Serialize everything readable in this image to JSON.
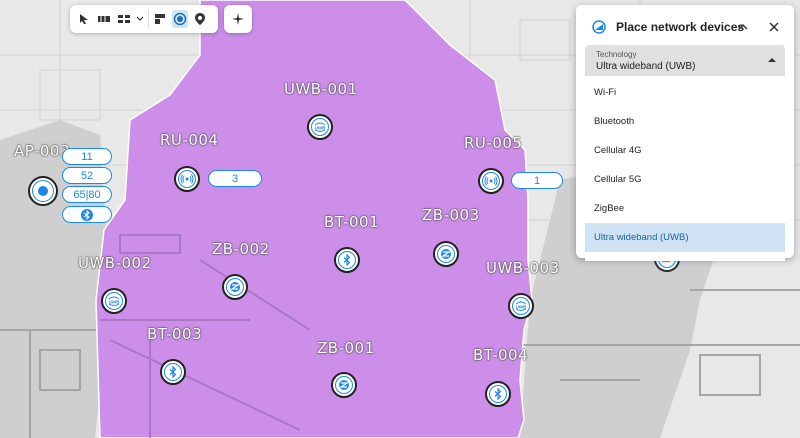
{
  "toolbar": {
    "tools": [
      "pointer-tool",
      "wall-tool",
      "grid-tool",
      "chevron",
      "layout-tool",
      "device-tool",
      "location-tool"
    ],
    "active_tool": "device-tool"
  },
  "colors": {
    "coverage": "#cc8ee8",
    "accent": "#1e88e5",
    "selected_bg": "#cfe3f4"
  },
  "devices": [
    {
      "id": "ap003",
      "label": "AP-003",
      "icon": "dot-icon"
    },
    {
      "id": "uwb001",
      "label": "UWB-001",
      "icon": "uwb-icon"
    },
    {
      "id": "ru004",
      "label": "RU-004",
      "icon": "radio-icon",
      "pill": "3"
    },
    {
      "id": "ru005",
      "label": "RU-005",
      "icon": "radio-icon",
      "pill": "1"
    },
    {
      "id": "bt001",
      "label": "BT-001",
      "icon": "bluetooth-icon"
    },
    {
      "id": "zb003",
      "label": "ZB-003",
      "icon": "zigbee-icon"
    },
    {
      "id": "zb002",
      "label": "ZB-002",
      "icon": "zigbee-icon"
    },
    {
      "id": "uwb002",
      "label": "UWB-002",
      "icon": "uwb-icon"
    },
    {
      "id": "uwb003",
      "label": "UWB-003",
      "icon": "uwb-icon"
    },
    {
      "id": "bt003",
      "label": "BT-003",
      "icon": "bluetooth-icon"
    },
    {
      "id": "zb001",
      "label": "ZB-001",
      "icon": "zigbee-icon"
    },
    {
      "id": "bt004",
      "label": "BT-004",
      "icon": "bluetooth-icon"
    }
  ],
  "ap_stats": [
    "11",
    "52",
    "65|80"
  ],
  "ap_bluetooth_icon": "bluetooth-icon",
  "panel": {
    "title": "Place network devices",
    "field_label": "Technology",
    "field_value": "Ultra wideband (UWB)",
    "options": [
      "Wi-Fi",
      "Bluetooth",
      "Cellular 4G",
      "Cellular 5G",
      "ZigBee",
      "Ultra wideband (UWB)"
    ],
    "selected": "Ultra wideband (UWB)"
  }
}
